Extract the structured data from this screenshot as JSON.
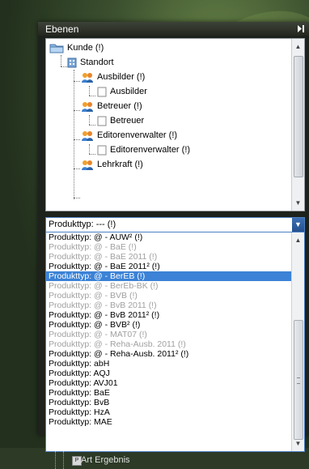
{
  "panel": {
    "title": "Ebenen"
  },
  "tree": {
    "items": [
      {
        "label": "Kunde (!)",
        "icon": "folder-icon"
      },
      {
        "label": "Standort",
        "icon": "building-icon"
      },
      {
        "label": "Ausbilder (!)",
        "icon": "users-icon"
      },
      {
        "label": "Ausbilder",
        "icon": "document-icon"
      },
      {
        "label": "Betreuer (!)",
        "icon": "users-icon"
      },
      {
        "label": "Betreuer",
        "icon": "document-icon"
      },
      {
        "label": "Editorenverwalter (!)",
        "icon": "users-icon"
      },
      {
        "label": "Editorenverwalter (!)",
        "icon": "document-icon"
      },
      {
        "label": "Lehrkraft (!)",
        "icon": "users-icon"
      }
    ]
  },
  "combo": {
    "value": "Produkttyp: --- (!)"
  },
  "dropdown": {
    "options": [
      {
        "label": "Produkttyp: @ - AUW² (!)",
        "state": "normal"
      },
      {
        "label": "Produkttyp: @ - BaE (!)",
        "state": "disabled"
      },
      {
        "label": "Produkttyp: @ - BaE 2011 (!)",
        "state": "disabled"
      },
      {
        "label": "Produkttyp: @ - BaE 2011² (!)",
        "state": "normal"
      },
      {
        "label": "Produkttyp: @ - BerEB (!)",
        "state": "selected"
      },
      {
        "label": "Produkttyp: @ - BerEb-BK (!)",
        "state": "disabled"
      },
      {
        "label": "Produkttyp: @ - BVB (!)",
        "state": "disabled"
      },
      {
        "label": "Produkttyp: @ - BvB 2011 (!)",
        "state": "disabled"
      },
      {
        "label": "Produkttyp: @ - BvB 2011² (!)",
        "state": "normal"
      },
      {
        "label": "Produkttyp: @ - BVB² (!)",
        "state": "normal"
      },
      {
        "label": "Produkttyp: @ - MAT07 (!)",
        "state": "disabled"
      },
      {
        "label": "Produkttyp: @ - Reha-Ausb. 2011 (!)",
        "state": "disabled"
      },
      {
        "label": "Produkttyp: @ - Reha-Ausb. 2011² (!)",
        "state": "normal"
      },
      {
        "label": "Produkttyp: abH",
        "state": "normal"
      },
      {
        "label": "Produkttyp: AQJ",
        "state": "normal"
      },
      {
        "label": "Produkttyp: AVJ01",
        "state": "normal"
      },
      {
        "label": "Produkttyp: BaE",
        "state": "normal"
      },
      {
        "label": "Produkttyp: BvB",
        "state": "normal"
      },
      {
        "label": "Produkttyp: HzA",
        "state": "normal"
      },
      {
        "label": "Produkttyp: MAE",
        "state": "normal"
      }
    ]
  },
  "bottom": {
    "label": "Art Ergebnis"
  },
  "colors": {
    "selection": "#3c82d6",
    "disabled_text": "#a0a0a0",
    "panel_bg": "#1e221c"
  }
}
